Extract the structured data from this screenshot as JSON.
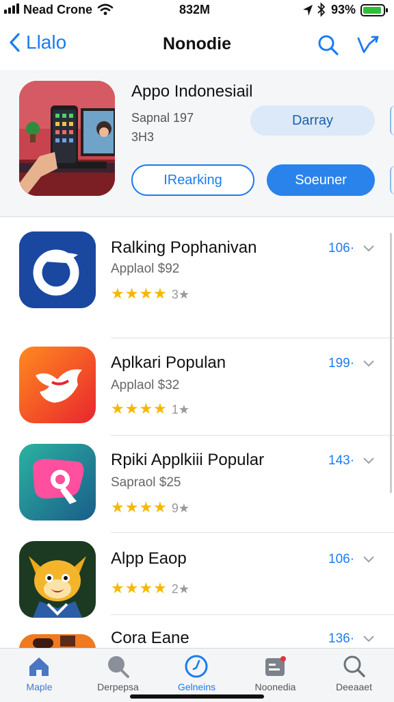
{
  "status_bar": {
    "carrier": "Nead Crone",
    "time": "832M",
    "battery": "93%"
  },
  "nav": {
    "back_label": "Llalo",
    "title": "Nonodie"
  },
  "featured": {
    "title": "Appo Indonesiail",
    "subtitle1": "Sapnal 197",
    "subtitle2": "3H3",
    "get_button": "Darray",
    "ranking_button": "IRearking",
    "second_button": "Soeuner"
  },
  "apps": [
    {
      "title": "Ralking Pophanivan",
      "subtitle": "Applaol $92",
      "stars": "★★★★",
      "rating": "3★",
      "price": "106·"
    },
    {
      "title": "Aplkari Populan",
      "subtitle": "Applaol $32",
      "stars": "★★★★",
      "rating": "1★",
      "price": "199·"
    },
    {
      "title": "Rpiki Applkiii Popular",
      "subtitle": "Sapraol $25",
      "stars": "★★★★",
      "rating": "9★",
      "price": "143·"
    },
    {
      "title": "Alpp Eaop",
      "subtitle": "",
      "stars": "★★★★",
      "rating": "2★",
      "price": "106·"
    },
    {
      "title": "Cora Eane",
      "subtitle": "",
      "stars": "",
      "rating": "",
      "price": "136·"
    }
  ],
  "tabs": [
    {
      "label": "Maple",
      "icon": "home-icon"
    },
    {
      "label": "Derpepsa",
      "icon": "search-icon"
    },
    {
      "label": "Gelneins",
      "icon": "compass-icon"
    },
    {
      "label": "Noonedia",
      "icon": "media-icon"
    },
    {
      "label": "Deeaaet",
      "icon": "search-icon"
    }
  ],
  "colors": {
    "accent": "#1a7cf0",
    "star": "#f5b800",
    "battery": "#2fbf3a"
  }
}
